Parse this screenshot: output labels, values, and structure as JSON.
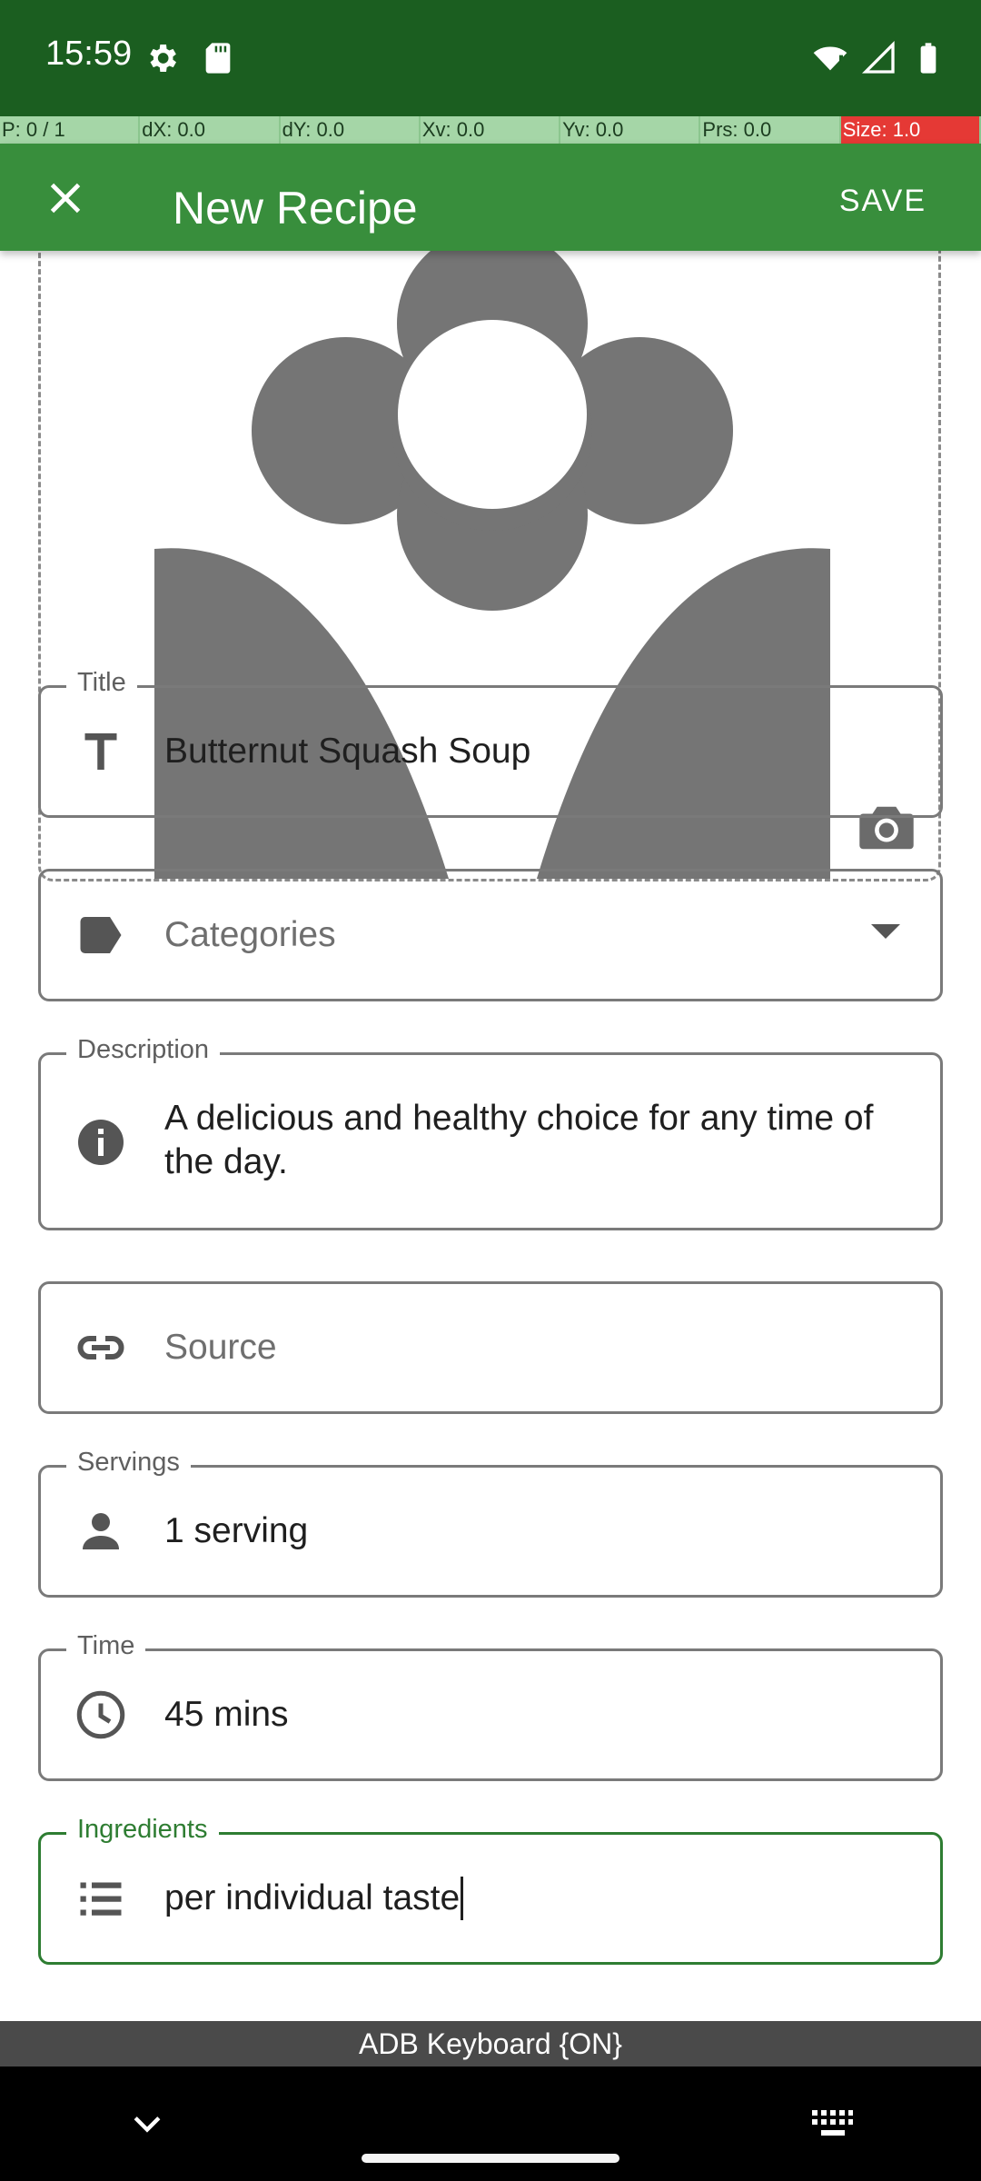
{
  "status_bar": {
    "time": "15:59",
    "left_icons": [
      "settings-icon",
      "sd-card-icon"
    ],
    "right_icons": [
      "wifi-icon",
      "signal-icon",
      "battery-icon"
    ]
  },
  "debug_bar": {
    "cells": [
      "P: 0 / 1",
      "dX: 0.0",
      "dY: 0.0",
      "Xv: 0.0",
      "Yv: 0.0",
      "Prs: 0.0",
      "Size: 1.0"
    ]
  },
  "app_bar": {
    "title": "New Recipe",
    "save_label": "SAVE",
    "close_icon": "close-icon"
  },
  "form": {
    "title": {
      "label": "Title",
      "value": "Butternut Squash Soup"
    },
    "categories": {
      "placeholder": "Categories"
    },
    "description": {
      "label": "Description",
      "value": "A delicious and healthy choice for any time of the day."
    },
    "source": {
      "placeholder": "Source"
    },
    "servings": {
      "label": "Servings",
      "value": "1 serving"
    },
    "time": {
      "label": "Time",
      "value": "45 mins"
    },
    "ingredients": {
      "label": "Ingredients",
      "value": "per individual taste"
    }
  },
  "keyboard": {
    "indicator": "ADB Keyboard {ON}"
  },
  "colors": {
    "status_bar": "#1b5e20",
    "app_bar": "#388e3c",
    "focus_accent": "#2e7d32"
  }
}
